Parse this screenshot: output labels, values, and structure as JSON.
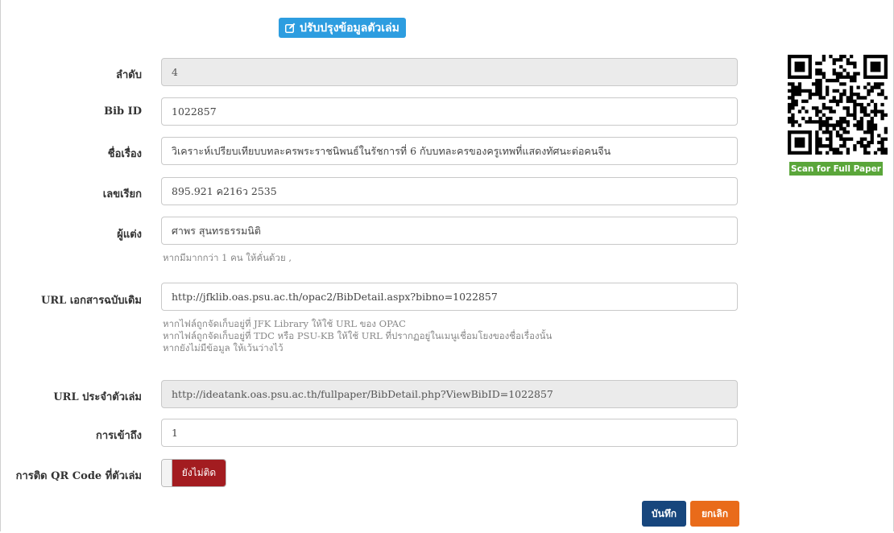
{
  "header": {
    "title": "ปรับปรุงข้อมูลตัวเล่ม",
    "icon": "edit-icon"
  },
  "form": {
    "order": {
      "label": "ลำดับ",
      "value": "4"
    },
    "bib_id": {
      "label": "Bib ID",
      "value": "1022857"
    },
    "title": {
      "label": "ชื่อเรื่อง",
      "value": "วิเคราะห์เปรียบเทียบบทละครพระราชนิพนธ์ในรัชการที่ 6 กับบทละครของครูเทพที่แสดงทัศนะต่อคนจีน"
    },
    "call_number": {
      "label": "เลขเรียก",
      "value": "895.921 ค216ว 2535"
    },
    "author": {
      "label": "ผู้แต่ง",
      "value": "ศาพร สุนทรธรรมนิติ",
      "help": "หากมีมากกว่า 1 คน ให้คั่นด้วย ,"
    },
    "original_url": {
      "label": "URL เอกสารฉบับเดิม",
      "value": "http://jfklib.oas.psu.ac.th/opac2/BibDetail.aspx?bibno=1022857",
      "help": [
        "หากไฟล์ถูกจัดเก็บอยู่ที่ JFK Library ให้ใช้ URL ของ OPAC",
        "หากไฟล์ถูกจัดเก็บอยู่ที่ TDC หรือ PSU-KB ให้ใช้ URL ที่ปรากฏอยู่ในเมนูเชื่อมโยงของชื่อเรื่องนั้น",
        "หากยังไม่มีข้อมูล ให้เว้นว่างไว้"
      ]
    },
    "volume_url": {
      "label": "URL ประจำตัวเล่ม",
      "value": "http://ideatank.oas.psu.ac.th/fullpaper/BibDetail.php?ViewBibID=1022857"
    },
    "access": {
      "label": "การเข้าถึง",
      "value": "1"
    },
    "qr_sticker": {
      "label": "การติด QR Code ที่ตัวเล่ม",
      "state_label": "ยังไม่ติด",
      "color": "#a31c20"
    }
  },
  "actions": {
    "save_label": "บันทึก",
    "cancel_label": "ยกเลิก",
    "save_color": "#17467d",
    "cancel_color": "#e96b1a"
  },
  "qr": {
    "badge": "Scan for Full Paper",
    "badge_color": "#5aa63a"
  }
}
